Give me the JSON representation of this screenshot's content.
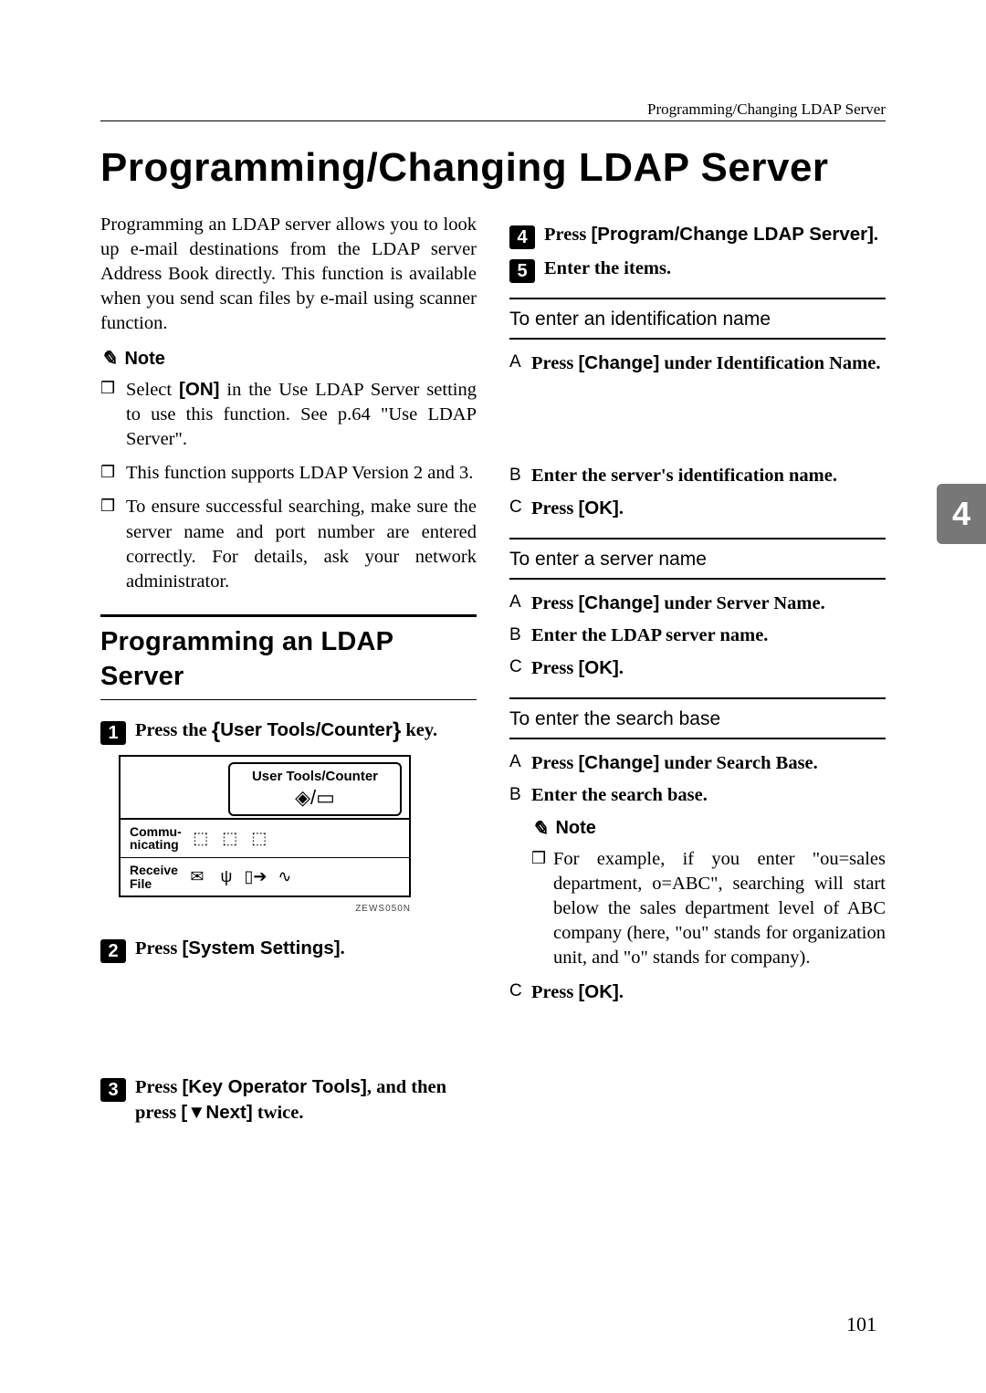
{
  "running_head": "Programming/Changing LDAP Server",
  "title": "Programming/Changing LDAP Server",
  "chapter_tab": "4",
  "page_number": "101",
  "intro": "Programming an LDAP server allows you to look up e-mail destinations from the LDAP server Address Book directly. This function is available when you send scan files by e-mail using scanner function.",
  "note_label": "Note",
  "notes": {
    "n1_a": "Select ",
    "n1_ui": "[ON]",
    "n1_b": " in the Use LDAP Server setting to use this function. See p.64 \"Use LDAP Server\".",
    "n2": "This function supports LDAP Version 2 and 3.",
    "n3": "To ensure successful searching, make sure the server name and port number are entered correctly. For details, ask your network administrator."
  },
  "section_heading": "Programming an LDAP Server",
  "steps": {
    "s1_a": "Press the ",
    "s1_key": "User Tools/Counter",
    "s1_b": " key.",
    "s2_a": "Press ",
    "s2_ui": "[System Settings]",
    "s2_b": ".",
    "s3_a": "Press ",
    "s3_ui": "[Key Operator Tools]",
    "s3_b": ", and then press ",
    "s3_ui2": "[▼Next]",
    "s3_c": " twice.",
    "s4_a": "Press ",
    "s4_ui": "[Program/Change LDAP Server]",
    "s4_b": ".",
    "s5": "Enter the items."
  },
  "panel": {
    "key_label": "User Tools/Counter",
    "row1_label": "Commu-\nnicating",
    "row2_label": "Receive\nFile"
  },
  "fig_code": "ZEWS050N",
  "sub1": {
    "heading": "To enter an identification name",
    "a_a": "Press ",
    "a_ui": "[Change]",
    "a_b": " under Identification Name.",
    "b": "Enter the server's identification name.",
    "c_a": "Press ",
    "c_ui": "[OK]",
    "c_b": "."
  },
  "sub2": {
    "heading": "To enter a server name",
    "a_a": "Press ",
    "a_ui": "[Change]",
    "a_b": " under Server Name.",
    "b": "Enter the LDAP server name.",
    "c_a": "Press ",
    "c_ui": "[OK]",
    "c_b": "."
  },
  "sub3": {
    "heading": "To enter the search base",
    "a_a": "Press ",
    "a_ui": "[Change]",
    "a_b": " under Search Base.",
    "b": "Enter the search base.",
    "note": "For example, if you enter \"ou=sales department, o=ABC\", searching will start below the sales department level of ABC company (here, \"ou\" stands for organization unit, and \"o\" stands for company).",
    "c_a": "Press ",
    "c_ui": "[OK]",
    "c_b": "."
  }
}
